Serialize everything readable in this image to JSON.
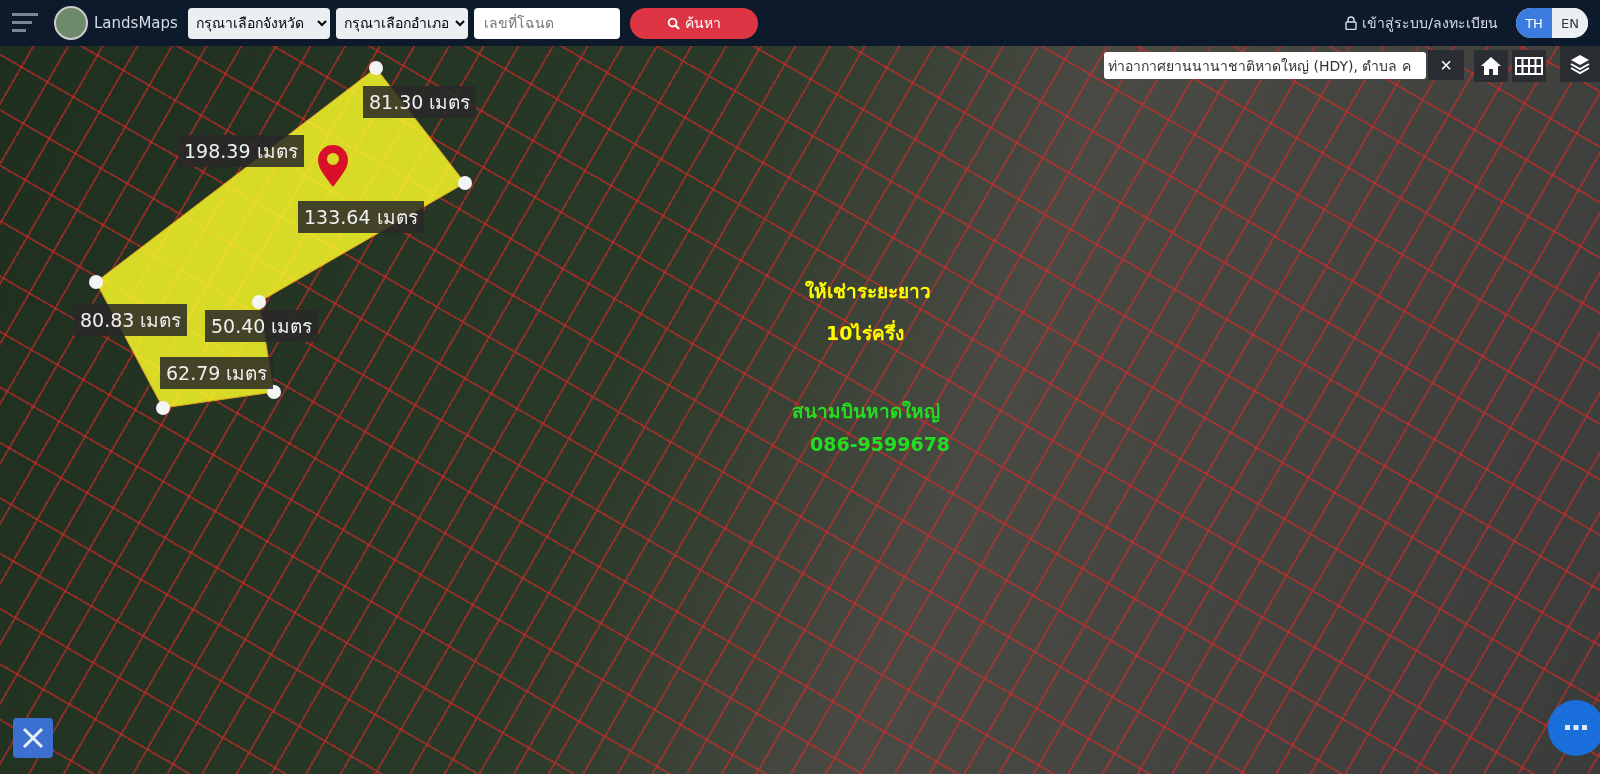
{
  "header": {
    "brand": "LandsMaps",
    "province_select": "กรุณาเลือกจังหวัด",
    "district_select": "กรุณาเลือกอำเภอ",
    "deed_search": {
      "placeholder": "เลขที่โฉนด"
    },
    "search_button": "ค้นหา",
    "login_link": "เข้าสู่ระบบ/ลงทะเบียน",
    "languages": [
      {
        "label": "TH",
        "selected": true
      },
      {
        "label": "EN",
        "selected": false
      }
    ]
  },
  "map": {
    "location_search": {
      "value": "ท่าอากาศยานนานาชาติหาดใหญ่ (HDY), ตำบล ค"
    },
    "clear_button": "×",
    "measurements": [
      "81.30 เมตร",
      "198.39 เมตร",
      "133.64 เมตร",
      "80.83 เมตร",
      "50.40 เมตร",
      "62.79 เมตร"
    ],
    "annotations": [
      {
        "text": "ให้เช่าระยะยาว",
        "color": "#ffff00"
      },
      {
        "text": "10ไร่ครึ่ง",
        "color": "#ffff00"
      },
      {
        "text": "สนามบินหาดใหญ่",
        "color": "#22dd22"
      },
      {
        "text": "086-9599678",
        "color": "#22dd22"
      }
    ]
  }
}
